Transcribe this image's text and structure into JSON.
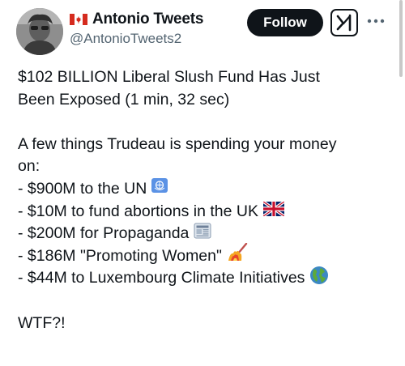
{
  "author": {
    "display_name": "Antonio Tweets",
    "handle": "@AntonioTweets2"
  },
  "actions": {
    "follow_label": "Follow",
    "grok_icon": "grok-icon",
    "more_icon": "more-options-icon"
  },
  "tweet": {
    "headline_1": "$102 BILLION Liberal Slush Fund Has Just",
    "headline_2": "Been Exposed (1 min, 32 sec)",
    "intro_1": "A few things Trudeau is spending your money",
    "intro_2": "on:",
    "items": [
      "- $900M to the UN",
      "- $10M to fund abortions in the UK",
      "- $200M for Propaganda",
      "- $186M \"Promoting Women\"",
      "- $44M to Luxembourg Climate Initiatives"
    ],
    "closing": "WTF?!"
  },
  "colors": {
    "text": "#0f1419",
    "secondary": "#536471",
    "button_bg": "#0f1419",
    "flag_red": "#d52b1e"
  }
}
